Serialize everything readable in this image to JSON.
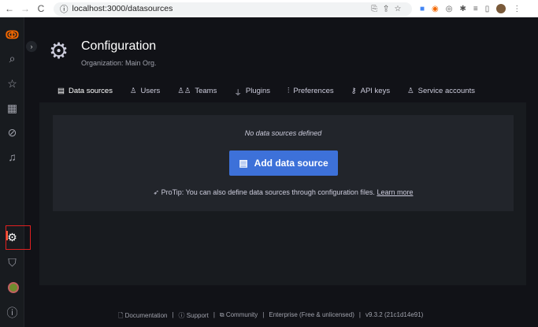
{
  "browser": {
    "url": "localhost:3000/datasources",
    "back": "←",
    "forward": "→",
    "reload": "C",
    "menu": "⋮"
  },
  "sidebar": {
    "expand": "›",
    "items": [
      "search",
      "starred",
      "dashboards",
      "explore",
      "alerting",
      "configuration",
      "server-admin",
      "profile",
      "help"
    ]
  },
  "header": {
    "title": "Configuration",
    "subtitle": "Organization: Main Org."
  },
  "tabs": [
    {
      "icon": "▤",
      "label": "Data sources"
    },
    {
      "icon": "♙",
      "label": "Users"
    },
    {
      "icon": "♙♙",
      "label": "Teams"
    },
    {
      "icon": "⏚",
      "label": "Plugins"
    },
    {
      "icon": "⫶",
      "label": "Preferences"
    },
    {
      "icon": "⚷",
      "label": "API keys"
    },
    {
      "icon": "♙",
      "label": "Service accounts"
    }
  ],
  "main": {
    "empty": "No data sources defined",
    "add_button": "Add data source",
    "tip": "ProTip: You can also define data sources through configuration files.",
    "tip_link": "Learn more"
  },
  "footer": {
    "documentation": "Documentation",
    "support": "Support",
    "community": "Community",
    "edition": "Enterprise (Free & unlicensed)",
    "version": "v9.3.2 (21c1d14e91)",
    "sep": "|"
  },
  "colors": {
    "accent": "#f55f3e",
    "primary": "#3d71d9"
  }
}
